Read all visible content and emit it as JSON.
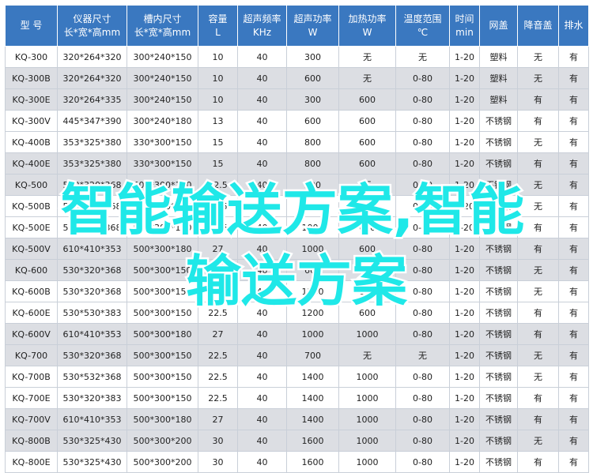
{
  "table": {
    "headers": [
      [
        "型 号"
      ],
      [
        "仪器尺寸",
        "长*宽*高mm"
      ],
      [
        "槽内尺寸",
        "长*宽*高mm"
      ],
      [
        "容量",
        "L"
      ],
      [
        "超声频率",
        "KHz"
      ],
      [
        "超声功率",
        "W"
      ],
      [
        "加热功率",
        "W"
      ],
      [
        "温度范围",
        "℃"
      ],
      [
        "时间",
        "min"
      ],
      [
        "网盖"
      ],
      [
        "降音盖"
      ],
      [
        "排水"
      ]
    ],
    "rows": [
      [
        "KQ-300",
        "320*264*320",
        "300*240*150",
        "10",
        "40",
        "300",
        "无",
        "无",
        "1-20",
        "塑料",
        "无",
        "有"
      ],
      [
        "KQ-300B",
        "320*264*320",
        "300*240*150",
        "10",
        "40",
        "600",
        "无",
        "0-80",
        "1-20",
        "塑料",
        "无",
        "有"
      ],
      [
        "KQ-300E",
        "320*264*335",
        "300*240*150",
        "10",
        "40",
        "300",
        "600",
        "0-80",
        "1-20",
        "塑料",
        "有",
        "有"
      ],
      [
        "KQ-300V",
        "445*347*390",
        "300*240*180",
        "13",
        "40",
        "600",
        "600",
        "0-80",
        "1-20",
        "不锈钢",
        "有",
        "有"
      ],
      [
        "KQ-400B",
        "353*325*380",
        "330*300*150",
        "15",
        "40",
        "800",
        "600",
        "0-80",
        "1-20",
        "不锈钢",
        "无",
        "有"
      ],
      [
        "KQ-400E",
        "353*325*380",
        "330*300*150",
        "15",
        "40",
        "800",
        "600",
        "0-80",
        "1-20",
        "不锈钢",
        "有",
        "有"
      ],
      [
        "KQ-500",
        "530*320*368",
        "500*300*150",
        "22.5",
        "40",
        "500",
        "无",
        "0-80",
        "1-20",
        "不锈钢",
        "无",
        "有"
      ],
      [
        "KQ-500B",
        "530*320*368",
        "500*300*150",
        "22.5",
        "40",
        "1000",
        "600",
        "0-80",
        "1-20",
        "不锈钢",
        "无",
        "有"
      ],
      [
        "KQ-500E",
        "530*320*368",
        "500*300*150",
        "22.5",
        "40",
        "1000",
        "600",
        "0-80",
        "1-20",
        "不锈钢",
        "有",
        "有"
      ],
      [
        "KQ-500V",
        "610*410*353",
        "500*300*180",
        "27",
        "40",
        "1000",
        "600",
        "0-80",
        "1-20",
        "不锈钢",
        "有",
        "有"
      ],
      [
        "KQ-600",
        "530*320*368",
        "500*300*150",
        "22.5",
        "40",
        "600",
        "无",
        "0-80",
        "1-20",
        "不锈钢",
        "无",
        "有"
      ],
      [
        "KQ-600B",
        "530*320*368",
        "500*300*150",
        "22.5",
        "40",
        "1200",
        "600",
        "0-80",
        "1-20",
        "不锈钢",
        "无",
        "有"
      ],
      [
        "KQ-600E",
        "530*530*383",
        "500*300*150",
        "22.5",
        "40",
        "1200",
        "600",
        "0-80",
        "1-20",
        "不锈钢",
        "有",
        "有"
      ],
      [
        "KQ-600V",
        "610*410*353",
        "500*300*180",
        "27",
        "40",
        "1000",
        "1000",
        "0-80",
        "1-20",
        "不锈钢",
        "有",
        "有"
      ],
      [
        "KQ-700",
        "530*320*368",
        "500*300*150",
        "22.5",
        "40",
        "700",
        "无",
        "无",
        "1-20",
        "不锈钢",
        "无",
        "有"
      ],
      [
        "KQ-700B",
        "530*532*368",
        "500*300*150",
        "22.5",
        "40",
        "1400",
        "1000",
        "0-80",
        "1-20",
        "不锈钢",
        "无",
        "有"
      ],
      [
        "KQ-700E",
        "530*320*383",
        "500*300*150",
        "22.5",
        "40",
        "1400",
        "1000",
        "0-80",
        "1-20",
        "不锈钢",
        "有",
        "有"
      ],
      [
        "KQ-700V",
        "610*410*353",
        "500*300*180",
        "27",
        "40",
        "1400",
        "1000",
        "0-80",
        "1-20",
        "不锈钢",
        "有",
        "有"
      ],
      [
        "KQ-800B",
        "530*325*430",
        "500*300*200",
        "30",
        "40",
        "1600",
        "1000",
        "0-80",
        "1-20",
        "不锈钢",
        "无",
        "有"
      ],
      [
        "KQ-800E",
        "530*325*430",
        "500*300*200",
        "30",
        "40",
        "1600",
        "1000",
        "0-80",
        "1-20",
        "不锈钢",
        "有",
        "有"
      ]
    ]
  },
  "watermark": {
    "line1": "智能输送方案,智能",
    "line2": "输送方案",
    "color": "#1fe8e8"
  },
  "colors": {
    "header_bg": "#3a78c0",
    "shaded_row": "#dcdee3",
    "border": "#c9cfd8"
  }
}
